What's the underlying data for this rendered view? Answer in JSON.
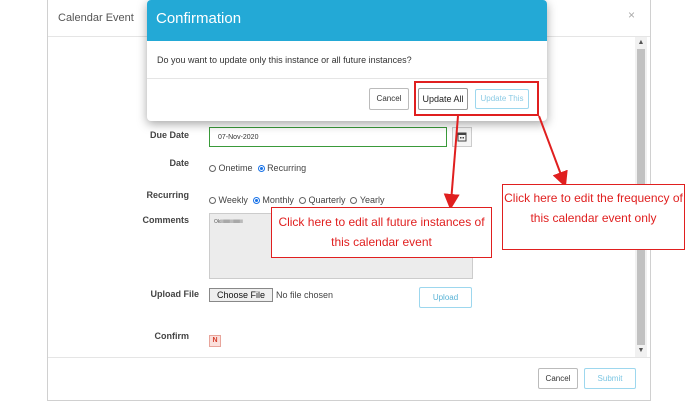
{
  "modal": {
    "title": "Calendar Event",
    "close_symbol": "×",
    "fields": {
      "due_date_label": "Due Date",
      "due_date_value": "07-Nov-2020",
      "date_label": "Date",
      "date_options": [
        "Onetime",
        "Recurring"
      ],
      "date_selected": "Recurring",
      "recurring_label": "Recurring",
      "recurring_options": [
        "Weekly",
        "Monthly",
        "Quarterly",
        "Yearly"
      ],
      "recurring_selected": "Monthly",
      "comments_label": "Comments",
      "comments_value": "Okiiiiiiiiiiiiiiiiiiii",
      "upload_label": "Upload File",
      "choose_file_label": "Choose File",
      "no_file_text": "No file chosen",
      "upload_button": "Upload",
      "confirm_label": "Confirm",
      "confirm_badge": "N"
    },
    "footer": {
      "cancel_label": "Cancel",
      "submit_label": "Submit"
    }
  },
  "confirmation": {
    "title": "Confirmation",
    "message": "Do you want to update only this instance or all future instances?",
    "cancel_label": "Cancel",
    "update_all_label": "Update All",
    "update_this_label": "Update This"
  },
  "annotations": {
    "update_all_note": "Click here to edit all future instances of this calendar event",
    "update_this_note": "Click here to edit the frequency of this calendar event only"
  },
  "colors": {
    "header_blue": "#23a9d6",
    "annotation_red": "#e01f1f",
    "focus_green": "#3a9a3a"
  }
}
